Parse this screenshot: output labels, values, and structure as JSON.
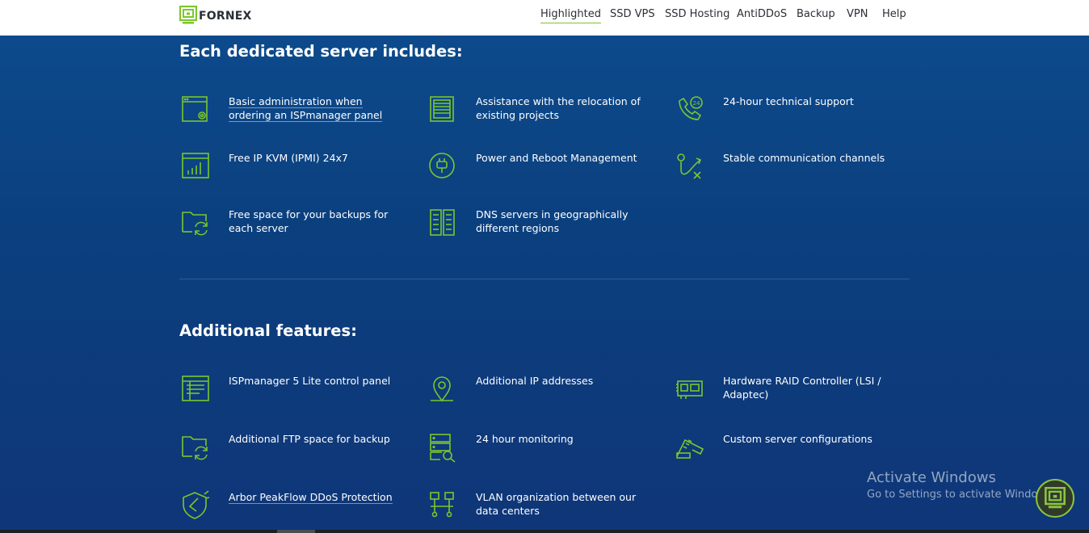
{
  "header": {
    "logo_text": "FORNEX",
    "nav": [
      {
        "label": "Highlighted",
        "active": true
      },
      {
        "label": "SSD VPS"
      },
      {
        "label": "SSD Hosting"
      },
      {
        "label": "AntiDDoS"
      },
      {
        "label": "Backup"
      },
      {
        "label": "VPN"
      },
      {
        "label": "Help"
      }
    ]
  },
  "included": {
    "title": "Each dedicated server includes:",
    "items": [
      {
        "label": "Basic administration when ordering an ISPmanager panel",
        "icon": "server-settings-icon",
        "link": true
      },
      {
        "label": "Assistance with the relocation of existing projects",
        "icon": "server-rack-icon"
      },
      {
        "label": "24-hour technical support",
        "icon": "phone-24-icon"
      },
      {
        "label": "Free IP KVM (IPMI) 24x7",
        "icon": "chart-window-icon"
      },
      {
        "label": "Power and Reboot Management",
        "icon": "power-plug-icon"
      },
      {
        "label": "Stable communication channels",
        "icon": "route-icon"
      },
      {
        "label": "Free space for your backups for each server",
        "icon": "folder-sync-icon"
      },
      {
        "label": "DNS servers in geographically different regions",
        "icon": "dns-servers-icon"
      }
    ]
  },
  "additional": {
    "title": "Additional features:",
    "items": [
      {
        "label": "ISPmanager 5 Lite control panel",
        "icon": "control-panel-icon"
      },
      {
        "label": "Additional IP addresses",
        "icon": "location-pin-icon"
      },
      {
        "label": "Hardware RAID Controller (LSI / Adaptec)",
        "icon": "raid-card-icon"
      },
      {
        "label": "Additional FTP space for backup",
        "icon": "folder-sync-icon"
      },
      {
        "label": "24 hour monitoring",
        "icon": "monitoring-icon"
      },
      {
        "label": "Custom server configurations",
        "icon": "memory-module-icon"
      },
      {
        "label": "Arbor PeakFlow DDoS Protection",
        "icon": "shield-icon",
        "link": true
      },
      {
        "label": "VLAN organization between our data centers",
        "icon": "network-icon"
      }
    ]
  },
  "watermark": {
    "title": "Activate Windows",
    "subtitle": "Go to Settings to activate Windows."
  },
  "colors": {
    "accent": "#7bc62d",
    "background": "#0c4583",
    "nav_text": "#2b2f36"
  }
}
